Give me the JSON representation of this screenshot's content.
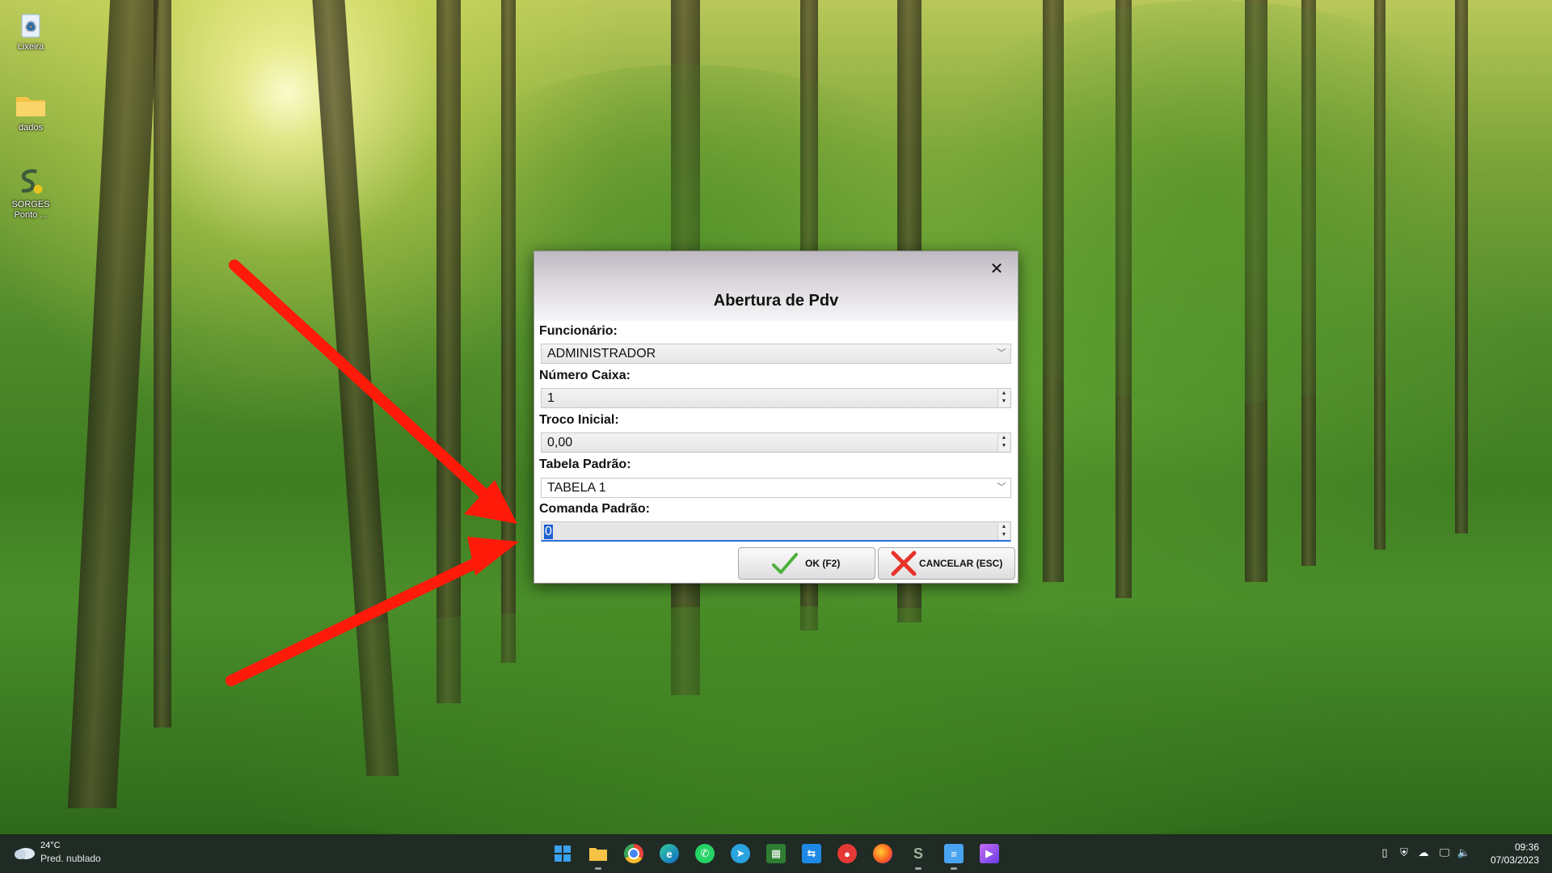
{
  "desktop": {
    "icons": [
      {
        "label": "Lixeira",
        "icon": "recycle-bin-icon"
      },
      {
        "label": "dados",
        "icon": "folder-icon"
      },
      {
        "label": "SORGES Ponto ...",
        "icon": "sorges-app-icon"
      }
    ]
  },
  "dialog": {
    "title": "Abertura de Pdv",
    "close_glyph": "✕",
    "fields": {
      "funcionario": {
        "label": "Funcionário:",
        "value": "ADMINISTRADOR"
      },
      "numero_caixa": {
        "label": "Número Caixa:",
        "value": "1"
      },
      "troco_inicial": {
        "label": "Troco Inicial:",
        "value": "0,00"
      },
      "tabela_padrao": {
        "label": "Tabela Padrão:",
        "value": "TABELA 1"
      },
      "comanda_padrao": {
        "label": "Comanda Padrão:",
        "value": "0"
      }
    },
    "buttons": {
      "ok_label": "OK (F2)",
      "cancel_label": "CANCELAR (ESC)"
    }
  },
  "taskbar": {
    "weather": {
      "temp": "24°C",
      "desc": "Pred. nublado"
    },
    "apps": [
      {
        "name": "start",
        "icon": "windows-start-icon"
      },
      {
        "name": "file-explorer",
        "icon": "folder-icon"
      },
      {
        "name": "chrome",
        "icon": "chrome-icon"
      },
      {
        "name": "edge",
        "icon": "edge-icon"
      },
      {
        "name": "whatsapp",
        "icon": "whatsapp-icon"
      },
      {
        "name": "telegram",
        "icon": "telegram-icon"
      },
      {
        "name": "spreadsheet",
        "icon": "spreadsheet-icon"
      },
      {
        "name": "remote",
        "icon": "remote-desktop-icon"
      },
      {
        "name": "app-red",
        "icon": "app-icon"
      },
      {
        "name": "firefox",
        "icon": "firefox-icon"
      },
      {
        "name": "sorges",
        "icon": "sorges-app-icon"
      },
      {
        "name": "notepad",
        "icon": "notepad-icon"
      },
      {
        "name": "media",
        "icon": "media-app-icon"
      }
    ],
    "clock": {
      "time": "09:36",
      "date": "07/03/2023"
    }
  },
  "colors": {
    "arrow": "#ff1a0a",
    "selection": "#1f62d4",
    "taskbar": "#1f2b24"
  }
}
